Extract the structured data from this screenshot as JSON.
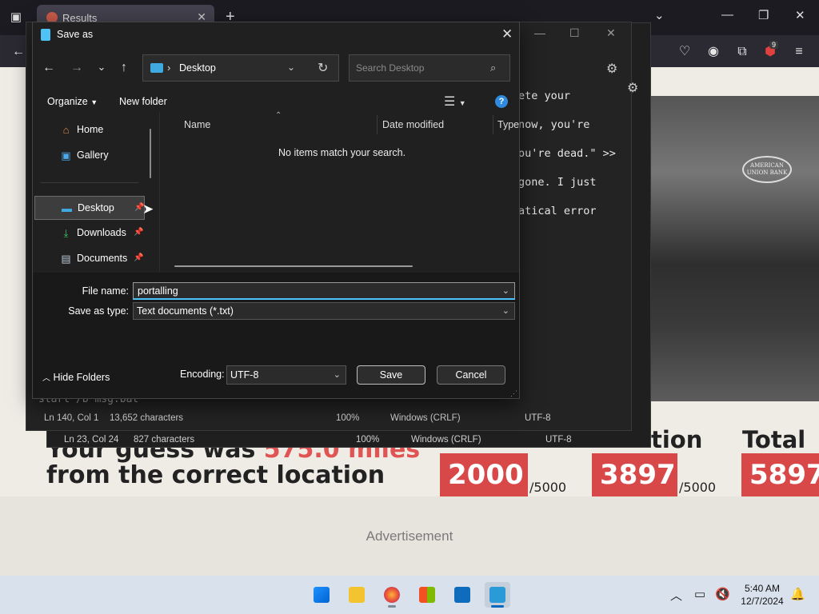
{
  "browser": {
    "tab_title": "Results",
    "extensions_badge": "9"
  },
  "webpage": {
    "guess_line1_prefix": "Your guess was ",
    "guess_line1_miles": "575.0 miles",
    "guess_line2": "from the correct location",
    "score_location_label": "tion",
    "score_total_label": "Total",
    "scores": [
      {
        "value": "2000",
        "max": "/5000"
      },
      {
        "value": "3897",
        "max": "/5000"
      },
      {
        "value": "5897",
        "max": ""
      }
    ],
    "ad_label": "Advertisement",
    "photo_sign_text": "AMERICAN UNION BANK"
  },
  "notepad": {
    "text_lines": [
      "ete your",
      "now, you're",
      "ou're dead.\" >>",
      "gone. I just",
      "atical error"
    ],
    "partial_line": "start /b msg.bat",
    "front_status": {
      "position": "Ln 140, Col 1",
      "chars": "13,652 characters",
      "zoom": "100%",
      "line_ending": "Windows (CRLF)",
      "encoding": "UTF-8"
    },
    "back_status": {
      "position": "Ln 23, Col 24",
      "chars": "827 characters",
      "zoom": "100%",
      "line_ending": "Windows (CRLF)",
      "encoding": "UTF-8"
    }
  },
  "dialog": {
    "title": "Save as",
    "address": "Desktop",
    "search_placeholder": "Search Desktop",
    "toolbar": {
      "organize": "Organize",
      "new_folder": "New folder"
    },
    "nav_items": [
      {
        "label": "Home",
        "icon": "home-icon",
        "pinned": false
      },
      {
        "label": "Gallery",
        "icon": "gallery-icon",
        "pinned": false
      },
      {
        "label": "Desktop",
        "icon": "desktop-folder-icon",
        "pinned": true
      },
      {
        "label": "Downloads",
        "icon": "download-icon",
        "pinned": true
      },
      {
        "label": "Documents",
        "icon": "documents-icon",
        "pinned": true
      }
    ],
    "columns": [
      "Name",
      "Date modified",
      "Type"
    ],
    "empty_message": "No items match your search.",
    "file_name_label": "File name:",
    "file_name_value": "portalling",
    "save_type_label": "Save as type:",
    "save_type_value": "Text documents (*.txt)",
    "hide_folders": "Hide Folders",
    "encoding_label": "Encoding:",
    "encoding_value": "UTF-8",
    "save_button": "Save",
    "cancel_button": "Cancel",
    "accent": "#4cc2ff"
  },
  "taskbar": {
    "apps": [
      "start-icon",
      "file-explorer-icon",
      "firefox-icon",
      "microsoft-store-icon",
      "outlook-new-icon",
      "notepad-icon"
    ],
    "time": "5:40 AM",
    "date": "12/7/2024"
  }
}
